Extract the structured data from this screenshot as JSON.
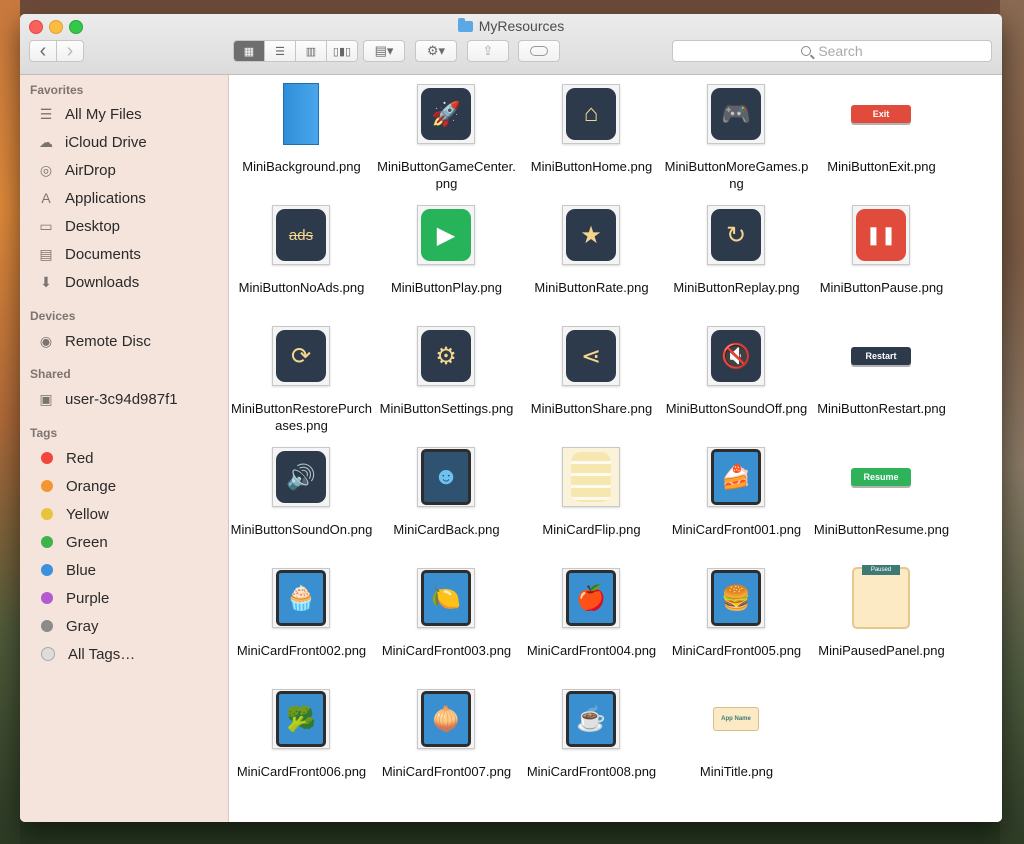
{
  "window": {
    "title": "MyResources"
  },
  "toolbar": {
    "back_glyph": "‹",
    "forward_glyph": "›",
    "view_modes": [
      "icon-view",
      "list-view",
      "column-view",
      "cover-flow-view"
    ],
    "search_placeholder": "Search",
    "share_glyph": "⇪",
    "arrange_glyph": "▤▾",
    "action_glyph": "⚙▾"
  },
  "sidebar": {
    "favorites_header": "Favorites",
    "favorites": [
      {
        "label": "All My Files",
        "icon": "all-files-icon",
        "glyph": "☰"
      },
      {
        "label": "iCloud Drive",
        "icon": "cloud-icon",
        "glyph": "☁"
      },
      {
        "label": "AirDrop",
        "icon": "airdrop-icon",
        "glyph": "◎"
      },
      {
        "label": "Applications",
        "icon": "applications-icon",
        "glyph": "A"
      },
      {
        "label": "Desktop",
        "icon": "desktop-icon",
        "glyph": "▭"
      },
      {
        "label": "Documents",
        "icon": "documents-icon",
        "glyph": "▤"
      },
      {
        "label": "Downloads",
        "icon": "downloads-icon",
        "glyph": "⬇"
      }
    ],
    "devices_header": "Devices",
    "devices": [
      {
        "label": "Remote Disc",
        "icon": "disc-icon",
        "glyph": "◉"
      }
    ],
    "shared_header": "Shared",
    "shared": [
      {
        "label": "user-3c94d987f1",
        "icon": "computer-icon",
        "glyph": "▣"
      }
    ],
    "tags_header": "Tags",
    "tags": [
      {
        "label": "Red",
        "color": "#f1453d"
      },
      {
        "label": "Orange",
        "color": "#f39532"
      },
      {
        "label": "Yellow",
        "color": "#e8c43a"
      },
      {
        "label": "Green",
        "color": "#3fb24a"
      },
      {
        "label": "Blue",
        "color": "#3a92df"
      },
      {
        "label": "Purple",
        "color": "#b45ad0"
      },
      {
        "label": "Gray",
        "color": "#8b8b8b"
      },
      {
        "label": "All Tags…",
        "color": "#dddddd"
      }
    ]
  },
  "files": [
    {
      "name": "MiniBackground.png",
      "kind": "bg"
    },
    {
      "name": "MiniButtonGameCenter.png",
      "kind": "dark",
      "glyph": "🚀"
    },
    {
      "name": "MiniButtonHome.png",
      "kind": "dark",
      "glyph": "⌂"
    },
    {
      "name": "MiniButtonMoreGames.png",
      "kind": "dark",
      "glyph": "🎮"
    },
    {
      "name": "MiniButtonExit.png",
      "kind": "pill",
      "label": "Exit",
      "color": "#e04b3c"
    },
    {
      "name": "MiniButtonNoAds.png",
      "kind": "dark",
      "glyph": "ads"
    },
    {
      "name": "MiniButtonPlay.png",
      "kind": "play",
      "glyph": "▶"
    },
    {
      "name": "MiniButtonRate.png",
      "kind": "dark",
      "glyph": "★"
    },
    {
      "name": "MiniButtonReplay.png",
      "kind": "dark",
      "glyph": "↻"
    },
    {
      "name": "MiniButtonPause.png",
      "kind": "pause",
      "glyph": "❚❚"
    },
    {
      "name": "MiniButtonRestorePurchases.png",
      "kind": "dark",
      "glyph": "⟳"
    },
    {
      "name": "MiniButtonSettings.png",
      "kind": "dark",
      "glyph": "⚙"
    },
    {
      "name": "MiniButtonShare.png",
      "kind": "dark",
      "glyph": "⋖"
    },
    {
      "name": "MiniButtonSoundOff.png",
      "kind": "dark",
      "glyph": "🔇"
    },
    {
      "name": "MiniButtonRestart.png",
      "kind": "pill",
      "label": "Restart",
      "color": "#2d3a4b"
    },
    {
      "name": "MiniButtonSoundOn.png",
      "kind": "dark",
      "glyph": "🔊"
    },
    {
      "name": "MiniCardBack.png",
      "kind": "cardback",
      "glyph": "☻"
    },
    {
      "name": "MiniCardFlip.png",
      "kind": "flip"
    },
    {
      "name": "MiniCardFront001.png",
      "kind": "card",
      "glyph": "🍰"
    },
    {
      "name": "MiniButtonResume.png",
      "kind": "pill",
      "label": "Resume",
      "color": "#2fb35a"
    },
    {
      "name": "MiniCardFront002.png",
      "kind": "card",
      "glyph": "🧁"
    },
    {
      "name": "MiniCardFront003.png",
      "kind": "card",
      "glyph": "🍋"
    },
    {
      "name": "MiniCardFront004.png",
      "kind": "card",
      "glyph": "🍎"
    },
    {
      "name": "MiniCardFront005.png",
      "kind": "card",
      "glyph": "🍔"
    },
    {
      "name": "MiniPausedPanel.png",
      "kind": "panel",
      "label": "Paused"
    },
    {
      "name": "MiniCardFront006.png",
      "kind": "card",
      "glyph": "🥦"
    },
    {
      "name": "MiniCardFront007.png",
      "kind": "card",
      "glyph": "🧅"
    },
    {
      "name": "MiniCardFront008.png",
      "kind": "card",
      "glyph": "☕"
    },
    {
      "name": "MiniTitle.png",
      "kind": "titlebanner",
      "label": "App Name"
    }
  ]
}
